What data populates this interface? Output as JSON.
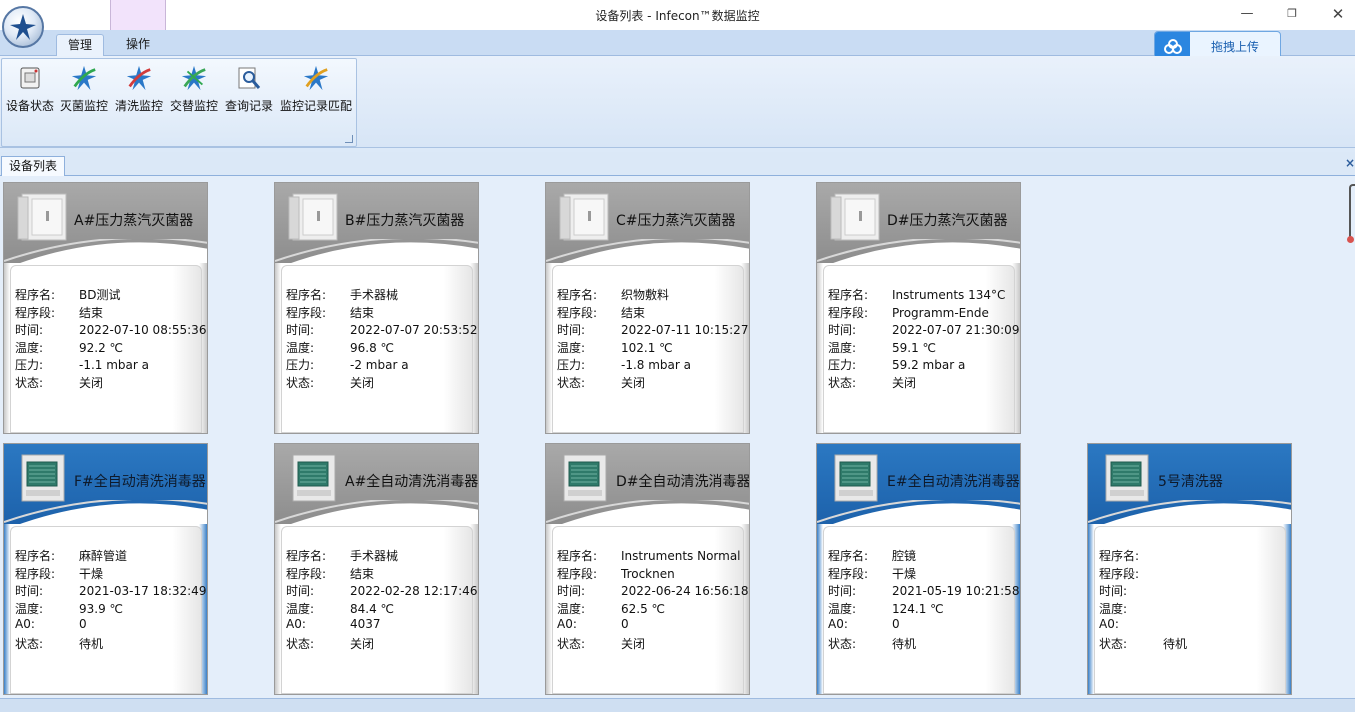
{
  "window": {
    "title": "设备列表 - Infecon™数据监控",
    "minimize": "—",
    "maximize": "❐",
    "close": "✕"
  },
  "ribbon": {
    "tabs": [
      "管理",
      "操作"
    ],
    "buttons": [
      {
        "label": "设备状态",
        "icon": "device-status-icon"
      },
      {
        "label": "灭菌监控",
        "icon": "sterilize-monitor-icon"
      },
      {
        "label": "清洗监控",
        "icon": "wash-monitor-icon"
      },
      {
        "label": "交替监控",
        "icon": "alternate-monitor-icon"
      },
      {
        "label": "查询记录",
        "icon": "query-record-icon"
      },
      {
        "label": "监控记录匹配",
        "icon": "record-match-icon"
      }
    ]
  },
  "upload": {
    "label": "拖拽上传"
  },
  "doc_tab": {
    "label": "设备列表",
    "close": "×"
  },
  "field_labels": {
    "program": "程序名:",
    "stage": "程序段:",
    "time": "时间:",
    "temp": "温度:",
    "pressure": "压力:",
    "a0": "A0:",
    "status": "状态:"
  },
  "devices": [
    {
      "name": "A#压力蒸汽灭菌器",
      "theme": "gray",
      "kind": "sterilizer",
      "program": "BD测试",
      "stage": "结束",
      "time": "2022-07-10 08:55:36",
      "temp": "92.2  ℃",
      "third_key": "pressure",
      "third": "-1.1  mbar a",
      "status": "关闭"
    },
    {
      "name": "B#压力蒸汽灭菌器",
      "theme": "gray",
      "kind": "sterilizer",
      "program": "手术器械",
      "stage": "结束",
      "time": "2022-07-07 20:53:52",
      "temp": "96.8  ℃",
      "third_key": "pressure",
      "third": "-2  mbar a",
      "status": "关闭"
    },
    {
      "name": "C#压力蒸汽灭菌器",
      "theme": "gray",
      "kind": "sterilizer",
      "program": "织物敷料",
      "stage": "结束",
      "time": "2022-07-11 10:15:27",
      "temp": "102.1  ℃",
      "third_key": "pressure",
      "third": "-1.8  mbar a",
      "status": "关闭"
    },
    {
      "name": "D#压力蒸汽灭菌器",
      "theme": "gray",
      "kind": "sterilizer",
      "program": "Instruments 134°C",
      "stage": "Programm-Ende",
      "time": "2022-07-07 21:30:09",
      "temp": "59.1  ℃",
      "third_key": "pressure",
      "third": "59.2  mbar a",
      "status": "关闭"
    },
    {
      "name": "F#全自动清洗消毒器",
      "theme": "blue",
      "kind": "washer",
      "program": "麻醉管道",
      "stage": "干燥",
      "time": "2021-03-17 18:32:49",
      "temp": "93.9  ℃",
      "third_key": "a0",
      "third": "0",
      "status": "待机"
    },
    {
      "name": "A#全自动清洗消毒器",
      "theme": "gray",
      "kind": "washer",
      "program": "手术器械",
      "stage": "结束",
      "time": "2022-02-28 12:17:46",
      "temp": "84.4  ℃",
      "third_key": "a0",
      "third": "4037",
      "status": "关闭"
    },
    {
      "name": "D#全自动清洗消毒器",
      "theme": "gray",
      "kind": "washer",
      "program": "Instruments Normal",
      "stage": "Trocknen",
      "time": "2022-06-24 16:56:18",
      "temp": "62.5  ℃",
      "third_key": "a0",
      "third": "0",
      "status": "关闭"
    },
    {
      "name": "E#全自动清洗消毒器",
      "theme": "blue",
      "kind": "washer",
      "program": "腔镜",
      "stage": "干燥",
      "time": "2021-05-19 10:21:58",
      "temp": "124.1  ℃",
      "third_key": "a0",
      "third": "0",
      "status": "待机"
    },
    {
      "name": "5号清洗器",
      "theme": "blue",
      "kind": "washer",
      "program": "",
      "stage": "",
      "time": "",
      "temp": "",
      "third_key": "a0",
      "third": "",
      "status": "待机"
    }
  ],
  "colors": {
    "card_gray": "#9a9a9a",
    "card_blue": "#2270b9",
    "upload_accent": "#2b86e0"
  }
}
